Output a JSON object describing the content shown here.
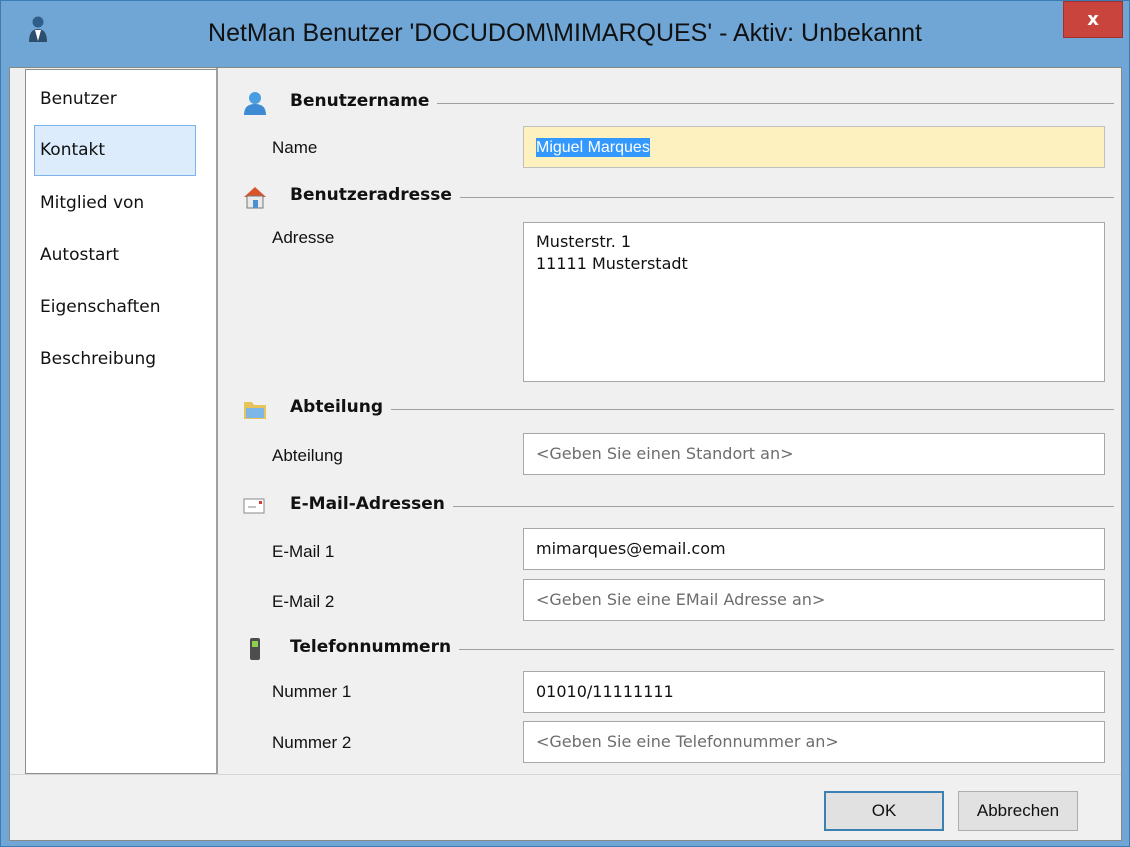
{
  "window": {
    "title": "NetMan Benutzer 'DOCUDOM\\MIMARQUES' - Aktiv: Unbekannt",
    "close_label": "x",
    "icon": "user-icon"
  },
  "sidebar": {
    "items": [
      {
        "label": "Benutzer",
        "active": false
      },
      {
        "label": "Kontakt",
        "active": true
      },
      {
        "label": "Mitglied von",
        "active": false
      },
      {
        "label": "Autostart",
        "active": false
      },
      {
        "label": "Eigenschaften",
        "active": false
      },
      {
        "label": "Beschreibung",
        "active": false
      }
    ]
  },
  "sections": {
    "username": {
      "title": "Benutzername",
      "icon": "user-icon",
      "name_label": "Name",
      "name_value": "Miguel Marques"
    },
    "address": {
      "title": "Benutzeradresse",
      "icon": "house-icon",
      "address_label": "Adresse",
      "address_lines": [
        "Musterstr. 1",
        "11111 Musterstadt"
      ]
    },
    "department": {
      "title": "Abteilung",
      "icon": "folder-icon",
      "department_label": "Abteilung",
      "department_placeholder": "<Geben Sie einen Standort an>"
    },
    "email": {
      "title": "E-Mail-Adressen",
      "icon": "envelope-icon",
      "email1_label": "E-Mail 1",
      "email1_value": "mimarques@email.com",
      "email2_label": "E-Mail 2",
      "email2_placeholder": "<Geben Sie eine EMail Adresse an>"
    },
    "phone": {
      "title": "Telefonnummern",
      "icon": "phone-icon",
      "phone1_label": "Nummer 1",
      "phone1_value": "01010/11111111",
      "phone2_label": "Nummer 2",
      "phone2_placeholder": "<Geben Sie eine Telefonnummer an>"
    }
  },
  "footer": {
    "ok_label": "OK",
    "cancel_label": "Abbrechen"
  },
  "colors": {
    "titlebar": "#6fa6d6",
    "close_button": "#c9443c",
    "selection": "#3399ff",
    "focused_field": "#fdf1c0",
    "active_nav": "#dcecfc"
  }
}
